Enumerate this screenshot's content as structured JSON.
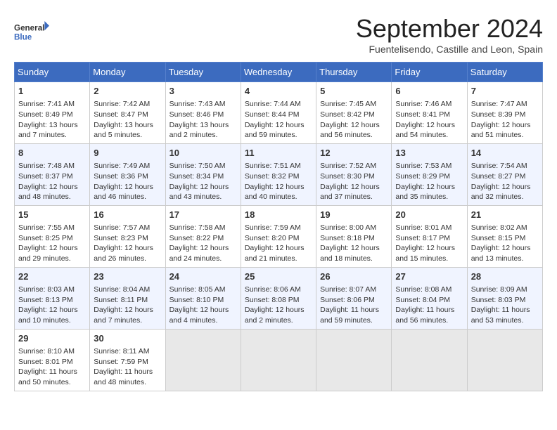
{
  "header": {
    "logo_line1": "General",
    "logo_line2": "Blue",
    "month": "September 2024",
    "location": "Fuentelisendo, Castille and Leon, Spain"
  },
  "days_of_week": [
    "Sunday",
    "Monday",
    "Tuesday",
    "Wednesday",
    "Thursday",
    "Friday",
    "Saturday"
  ],
  "weeks": [
    [
      {
        "day": 1,
        "info": "Sunrise: 7:41 AM\nSunset: 8:49 PM\nDaylight: 13 hours\nand 7 minutes."
      },
      {
        "day": 2,
        "info": "Sunrise: 7:42 AM\nSunset: 8:47 PM\nDaylight: 13 hours\nand 5 minutes."
      },
      {
        "day": 3,
        "info": "Sunrise: 7:43 AM\nSunset: 8:46 PM\nDaylight: 13 hours\nand 2 minutes."
      },
      {
        "day": 4,
        "info": "Sunrise: 7:44 AM\nSunset: 8:44 PM\nDaylight: 12 hours\nand 59 minutes."
      },
      {
        "day": 5,
        "info": "Sunrise: 7:45 AM\nSunset: 8:42 PM\nDaylight: 12 hours\nand 56 minutes."
      },
      {
        "day": 6,
        "info": "Sunrise: 7:46 AM\nSunset: 8:41 PM\nDaylight: 12 hours\nand 54 minutes."
      },
      {
        "day": 7,
        "info": "Sunrise: 7:47 AM\nSunset: 8:39 PM\nDaylight: 12 hours\nand 51 minutes."
      }
    ],
    [
      {
        "day": 8,
        "info": "Sunrise: 7:48 AM\nSunset: 8:37 PM\nDaylight: 12 hours\nand 48 minutes."
      },
      {
        "day": 9,
        "info": "Sunrise: 7:49 AM\nSunset: 8:36 PM\nDaylight: 12 hours\nand 46 minutes."
      },
      {
        "day": 10,
        "info": "Sunrise: 7:50 AM\nSunset: 8:34 PM\nDaylight: 12 hours\nand 43 minutes."
      },
      {
        "day": 11,
        "info": "Sunrise: 7:51 AM\nSunset: 8:32 PM\nDaylight: 12 hours\nand 40 minutes."
      },
      {
        "day": 12,
        "info": "Sunrise: 7:52 AM\nSunset: 8:30 PM\nDaylight: 12 hours\nand 37 minutes."
      },
      {
        "day": 13,
        "info": "Sunrise: 7:53 AM\nSunset: 8:29 PM\nDaylight: 12 hours\nand 35 minutes."
      },
      {
        "day": 14,
        "info": "Sunrise: 7:54 AM\nSunset: 8:27 PM\nDaylight: 12 hours\nand 32 minutes."
      }
    ],
    [
      {
        "day": 15,
        "info": "Sunrise: 7:55 AM\nSunset: 8:25 PM\nDaylight: 12 hours\nand 29 minutes."
      },
      {
        "day": 16,
        "info": "Sunrise: 7:57 AM\nSunset: 8:23 PM\nDaylight: 12 hours\nand 26 minutes."
      },
      {
        "day": 17,
        "info": "Sunrise: 7:58 AM\nSunset: 8:22 PM\nDaylight: 12 hours\nand 24 minutes."
      },
      {
        "day": 18,
        "info": "Sunrise: 7:59 AM\nSunset: 8:20 PM\nDaylight: 12 hours\nand 21 minutes."
      },
      {
        "day": 19,
        "info": "Sunrise: 8:00 AM\nSunset: 8:18 PM\nDaylight: 12 hours\nand 18 minutes."
      },
      {
        "day": 20,
        "info": "Sunrise: 8:01 AM\nSunset: 8:17 PM\nDaylight: 12 hours\nand 15 minutes."
      },
      {
        "day": 21,
        "info": "Sunrise: 8:02 AM\nSunset: 8:15 PM\nDaylight: 12 hours\nand 13 minutes."
      }
    ],
    [
      {
        "day": 22,
        "info": "Sunrise: 8:03 AM\nSunset: 8:13 PM\nDaylight: 12 hours\nand 10 minutes."
      },
      {
        "day": 23,
        "info": "Sunrise: 8:04 AM\nSunset: 8:11 PM\nDaylight: 12 hours\nand 7 minutes."
      },
      {
        "day": 24,
        "info": "Sunrise: 8:05 AM\nSunset: 8:10 PM\nDaylight: 12 hours\nand 4 minutes."
      },
      {
        "day": 25,
        "info": "Sunrise: 8:06 AM\nSunset: 8:08 PM\nDaylight: 12 hours\nand 2 minutes."
      },
      {
        "day": 26,
        "info": "Sunrise: 8:07 AM\nSunset: 8:06 PM\nDaylight: 11 hours\nand 59 minutes."
      },
      {
        "day": 27,
        "info": "Sunrise: 8:08 AM\nSunset: 8:04 PM\nDaylight: 11 hours\nand 56 minutes."
      },
      {
        "day": 28,
        "info": "Sunrise: 8:09 AM\nSunset: 8:03 PM\nDaylight: 11 hours\nand 53 minutes."
      }
    ],
    [
      {
        "day": 29,
        "info": "Sunrise: 8:10 AM\nSunset: 8:01 PM\nDaylight: 11 hours\nand 50 minutes."
      },
      {
        "day": 30,
        "info": "Sunrise: 8:11 AM\nSunset: 7:59 PM\nDaylight: 11 hours\nand 48 minutes."
      },
      {
        "day": null,
        "info": ""
      },
      {
        "day": null,
        "info": ""
      },
      {
        "day": null,
        "info": ""
      },
      {
        "day": null,
        "info": ""
      },
      {
        "day": null,
        "info": ""
      }
    ]
  ]
}
